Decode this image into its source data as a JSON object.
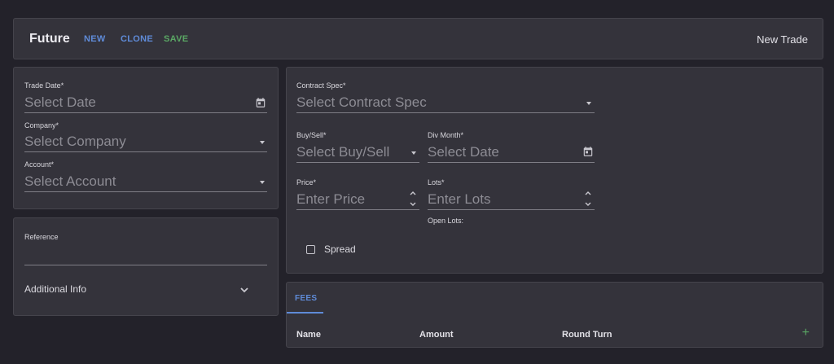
{
  "header": {
    "title": "Future",
    "new_label": "NEW",
    "clone_label": "CLONE",
    "save_label": "SAVE",
    "right_title": "New Trade"
  },
  "trade_details": {
    "trade_date": {
      "label": "Trade Date*",
      "placeholder": "Select Date"
    },
    "company": {
      "label": "Company*",
      "placeholder": "Select Company"
    },
    "account": {
      "label": "Account*",
      "placeholder": "Select Account"
    }
  },
  "reference": {
    "label": "Reference",
    "value": "",
    "additional_info_label": "Additional Info"
  },
  "contract": {
    "contract_spec": {
      "label": "Contract Spec*",
      "placeholder": "Select Contract Spec"
    },
    "buy_sell": {
      "label": "Buy/Sell*",
      "placeholder": "Select Buy/Sell"
    },
    "div_month": {
      "label": "Div Month*",
      "placeholder": "Select Date"
    },
    "price": {
      "label": "Price*",
      "placeholder": "Enter Price"
    },
    "lots": {
      "label": "Lots*",
      "placeholder": "Enter Lots"
    },
    "open_lots_label": "Open Lots:",
    "spread_label": "Spread",
    "spread_checked": false
  },
  "fees": {
    "tab_label": "FEES",
    "columns": [
      "Name",
      "Amount",
      "Round Turn"
    ],
    "add_icon": "plus-icon"
  },
  "colors": {
    "accent_blue": "#5f8bd8",
    "accent_green": "#5aa764",
    "background": "#23222a",
    "card": "#34333b"
  }
}
